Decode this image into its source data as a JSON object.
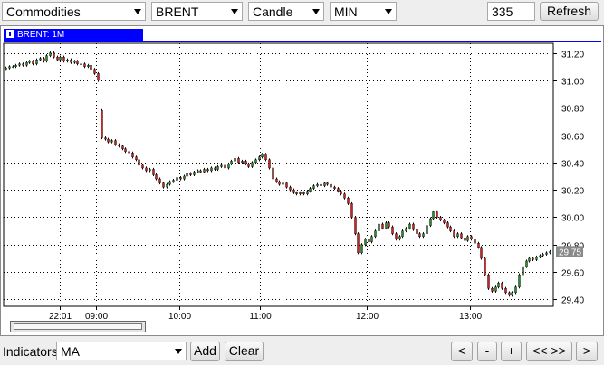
{
  "toolbar": {
    "category_select": "Commodities",
    "symbol_select": "BRENT",
    "charttype_select": "Candle",
    "interval_select": "MIN",
    "bars_input": "335",
    "refresh_label": "Refresh"
  },
  "chart_tab": {
    "label": "BRENT: 1M"
  },
  "bottom": {
    "indicators_label": "Indicators",
    "indicator_select": "MA",
    "add_label": "Add",
    "clear_label": "Clear",
    "nav_prev": "<",
    "nav_zoom_out": "-",
    "nav_zoom_in": "+",
    "nav_fit": "<< >>",
    "nav_next": ">"
  },
  "colors": {
    "up": "#2e8b2e",
    "down": "#cc2222",
    "tab": "#0000ff",
    "price_tag": "#8a8a8a"
  },
  "chart_data": {
    "type": "candlestick",
    "title": "BRENT: 1M",
    "ylim": [
      29.35,
      31.27
    ],
    "y_ticks": [
      "31.20",
      "31.00",
      "30.80",
      "30.60",
      "30.40",
      "30.20",
      "30.00",
      "29.80",
      "29.60",
      "29.40"
    ],
    "x_ticks": [
      "22:01",
      "09:00",
      "10:00",
      "11:00",
      "12:00",
      "13:00"
    ],
    "grid": true,
    "last_price": "29.75",
    "series": [
      {
        "o": 31.08,
        "c": 31.09
      },
      {
        "o": 31.09,
        "c": 31.1
      },
      {
        "o": 31.1,
        "c": 31.1
      },
      {
        "o": 31.1,
        "c": 31.11
      },
      {
        "o": 31.11,
        "c": 31.12
      },
      {
        "o": 31.12,
        "c": 31.11
      },
      {
        "o": 31.11,
        "c": 31.13
      },
      {
        "o": 31.13,
        "c": 31.14
      },
      {
        "o": 31.14,
        "c": 31.12
      },
      {
        "o": 31.12,
        "c": 31.15
      },
      {
        "o": 31.15,
        "c": 31.16
      },
      {
        "o": 31.16,
        "c": 31.14
      },
      {
        "o": 31.14,
        "c": 31.18
      },
      {
        "o": 31.18,
        "c": 31.2
      },
      {
        "o": 31.2,
        "c": 31.17
      },
      {
        "o": 31.17,
        "c": 31.15
      },
      {
        "o": 31.15,
        "c": 31.17
      },
      {
        "o": 31.17,
        "c": 31.14
      },
      {
        "o": 31.14,
        "c": 31.15
      },
      {
        "o": 31.15,
        "c": 31.13
      },
      {
        "o": 31.13,
        "c": 31.14
      },
      {
        "o": 31.14,
        "c": 31.12
      },
      {
        "o": 31.12,
        "c": 31.12
      },
      {
        "o": 31.12,
        "c": 31.1
      },
      {
        "o": 31.1,
        "c": 31.11
      },
      {
        "o": 31.11,
        "c": 31.08
      },
      {
        "o": 31.08,
        "c": 31.05
      },
      {
        "o": 31.05,
        "c": 31.0
      },
      {
        "o": 30.78,
        "c": 30.58
      },
      {
        "o": 30.58,
        "c": 30.57
      },
      {
        "o": 30.57,
        "c": 30.55
      },
      {
        "o": 30.55,
        "c": 30.56
      },
      {
        "o": 30.56,
        "c": 30.53
      },
      {
        "o": 30.53,
        "c": 30.52
      },
      {
        "o": 30.52,
        "c": 30.5
      },
      {
        "o": 30.5,
        "c": 30.48
      },
      {
        "o": 30.48,
        "c": 30.47
      },
      {
        "o": 30.47,
        "c": 30.44
      },
      {
        "o": 30.44,
        "c": 30.42
      },
      {
        "o": 30.42,
        "c": 30.38
      },
      {
        "o": 30.38,
        "c": 30.36
      },
      {
        "o": 30.36,
        "c": 30.34
      },
      {
        "o": 30.34,
        "c": 30.35
      },
      {
        "o": 30.35,
        "c": 30.31
      },
      {
        "o": 30.31,
        "c": 30.28
      },
      {
        "o": 30.28,
        "c": 30.25
      },
      {
        "o": 30.25,
        "c": 30.22
      },
      {
        "o": 30.22,
        "c": 30.24
      },
      {
        "o": 30.24,
        "c": 30.26
      },
      {
        "o": 30.26,
        "c": 30.27
      },
      {
        "o": 30.27,
        "c": 30.29
      },
      {
        "o": 30.29,
        "c": 30.28
      },
      {
        "o": 30.28,
        "c": 30.3
      },
      {
        "o": 30.3,
        "c": 30.32
      },
      {
        "o": 30.32,
        "c": 30.31
      },
      {
        "o": 30.31,
        "c": 30.33
      },
      {
        "o": 30.33,
        "c": 30.34
      },
      {
        "o": 30.34,
        "c": 30.33
      },
      {
        "o": 30.33,
        "c": 30.35
      },
      {
        "o": 30.35,
        "c": 30.34
      },
      {
        "o": 30.34,
        "c": 30.36
      },
      {
        "o": 30.36,
        "c": 30.35
      },
      {
        "o": 30.35,
        "c": 30.37
      },
      {
        "o": 30.37,
        "c": 30.38
      },
      {
        "o": 30.38,
        "c": 30.36
      },
      {
        "o": 30.36,
        "c": 30.39
      },
      {
        "o": 30.39,
        "c": 30.41
      },
      {
        "o": 30.41,
        "c": 30.43
      },
      {
        "o": 30.43,
        "c": 30.4
      },
      {
        "o": 30.4,
        "c": 30.41
      },
      {
        "o": 30.41,
        "c": 30.39
      },
      {
        "o": 30.39,
        "c": 30.37
      },
      {
        "o": 30.37,
        "c": 30.4
      },
      {
        "o": 30.4,
        "c": 30.42
      },
      {
        "o": 30.42,
        "c": 30.44
      },
      {
        "o": 30.44,
        "c": 30.46
      },
      {
        "o": 30.46,
        "c": 30.42
      },
      {
        "o": 30.42,
        "c": 30.36
      },
      {
        "o": 30.36,
        "c": 30.28
      },
      {
        "o": 30.28,
        "c": 30.26
      },
      {
        "o": 30.26,
        "c": 30.24
      },
      {
        "o": 30.24,
        "c": 30.25
      },
      {
        "o": 30.25,
        "c": 30.22
      },
      {
        "o": 30.22,
        "c": 30.2
      },
      {
        "o": 30.2,
        "c": 30.18
      },
      {
        "o": 30.18,
        "c": 30.17
      },
      {
        "o": 30.17,
        "c": 30.18
      },
      {
        "o": 30.18,
        "c": 30.17
      },
      {
        "o": 30.17,
        "c": 30.19
      },
      {
        "o": 30.19,
        "c": 30.21
      },
      {
        "o": 30.21,
        "c": 30.23
      },
      {
        "o": 30.23,
        "c": 30.24
      },
      {
        "o": 30.24,
        "c": 30.23
      },
      {
        "o": 30.23,
        "c": 30.25
      },
      {
        "o": 30.25,
        "c": 30.24
      },
      {
        "o": 30.24,
        "c": 30.22
      },
      {
        "o": 30.22,
        "c": 30.21
      },
      {
        "o": 30.21,
        "c": 30.19
      },
      {
        "o": 30.19,
        "c": 30.17
      },
      {
        "o": 30.17,
        "c": 30.14
      },
      {
        "o": 30.14,
        "c": 30.1
      },
      {
        "o": 30.1,
        "c": 30.0
      },
      {
        "o": 30.0,
        "c": 29.88
      },
      {
        "o": 29.88,
        "c": 29.74
      },
      {
        "o": 29.74,
        "c": 29.8
      },
      {
        "o": 29.8,
        "c": 29.84
      },
      {
        "o": 29.84,
        "c": 29.82
      },
      {
        "o": 29.82,
        "c": 29.86
      },
      {
        "o": 29.86,
        "c": 29.9
      },
      {
        "o": 29.9,
        "c": 29.95
      },
      {
        "o": 29.95,
        "c": 29.92
      },
      {
        "o": 29.92,
        "c": 29.96
      },
      {
        "o": 29.96,
        "c": 29.93
      },
      {
        "o": 29.93,
        "c": 29.88
      },
      {
        "o": 29.88,
        "c": 29.84
      },
      {
        "o": 29.84,
        "c": 29.86
      },
      {
        "o": 29.86,
        "c": 29.9
      },
      {
        "o": 29.9,
        "c": 29.92
      },
      {
        "o": 29.92,
        "c": 29.95
      },
      {
        "o": 29.95,
        "c": 29.91
      },
      {
        "o": 29.91,
        "c": 29.88
      },
      {
        "o": 29.88,
        "c": 29.86
      },
      {
        "o": 29.86,
        "c": 29.88
      },
      {
        "o": 29.88,
        "c": 29.94
      },
      {
        "o": 29.94,
        "c": 29.99
      },
      {
        "o": 29.99,
        "c": 30.04
      },
      {
        "o": 30.04,
        "c": 30.0
      },
      {
        "o": 30.0,
        "c": 29.98
      },
      {
        "o": 29.98,
        "c": 29.96
      },
      {
        "o": 29.96,
        "c": 29.93
      },
      {
        "o": 29.93,
        "c": 29.9
      },
      {
        "o": 29.9,
        "c": 29.86
      },
      {
        "o": 29.86,
        "c": 29.88
      },
      {
        "o": 29.88,
        "c": 29.85
      },
      {
        "o": 29.85,
        "c": 29.83
      },
      {
        "o": 29.83,
        "c": 29.86
      },
      {
        "o": 29.86,
        "c": 29.84
      },
      {
        "o": 29.84,
        "c": 29.81
      },
      {
        "o": 29.81,
        "c": 29.78
      },
      {
        "o": 29.78,
        "c": 29.7
      },
      {
        "o": 29.7,
        "c": 29.58
      },
      {
        "o": 29.58,
        "c": 29.48
      },
      {
        "o": 29.48,
        "c": 29.46
      },
      {
        "o": 29.46,
        "c": 29.49
      },
      {
        "o": 29.49,
        "c": 29.52
      },
      {
        "o": 29.52,
        "c": 29.48
      },
      {
        "o": 29.48,
        "c": 29.45
      },
      {
        "o": 29.45,
        "c": 29.43
      },
      {
        "o": 29.43,
        "c": 29.45
      },
      {
        "o": 29.45,
        "c": 29.49
      },
      {
        "o": 29.49,
        "c": 29.58
      },
      {
        "o": 29.58,
        "c": 29.64
      },
      {
        "o": 29.64,
        "c": 29.68
      },
      {
        "o": 29.68,
        "c": 29.7
      },
      {
        "o": 29.7,
        "c": 29.69
      },
      {
        "o": 29.69,
        "c": 29.71
      },
      {
        "o": 29.71,
        "c": 29.72
      },
      {
        "o": 29.72,
        "c": 29.73
      },
      {
        "o": 29.73,
        "c": 29.74
      },
      {
        "o": 29.74,
        "c": 29.75
      }
    ]
  }
}
